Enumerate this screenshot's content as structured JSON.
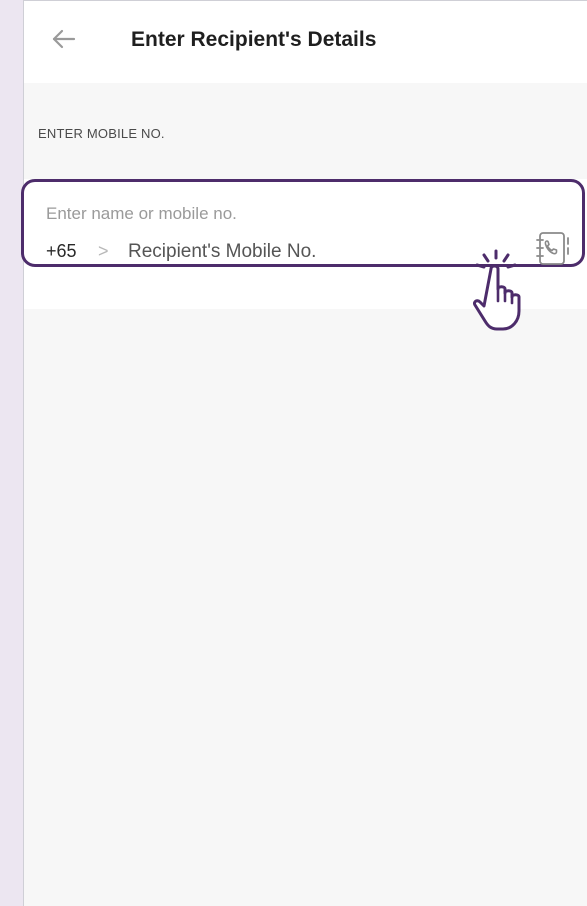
{
  "header": {
    "title": "Enter Recipient's Details",
    "back_icon": "arrow-left-icon"
  },
  "section": {
    "label": "ENTER MOBILE NO."
  },
  "recipient_input": {
    "hint": "Enter name or mobile no.",
    "country_code": "+65",
    "chevron_glyph": ">",
    "placeholder": "Recipient's Mobile No.",
    "contacts_icon": "phonebook-icon"
  },
  "overlay": {
    "tap_icon": "tap-hand-icon"
  },
  "colors": {
    "accent_border": "#4d2c6b",
    "page_background": "#f7f7f7",
    "outer_background": "#ece6f1"
  }
}
